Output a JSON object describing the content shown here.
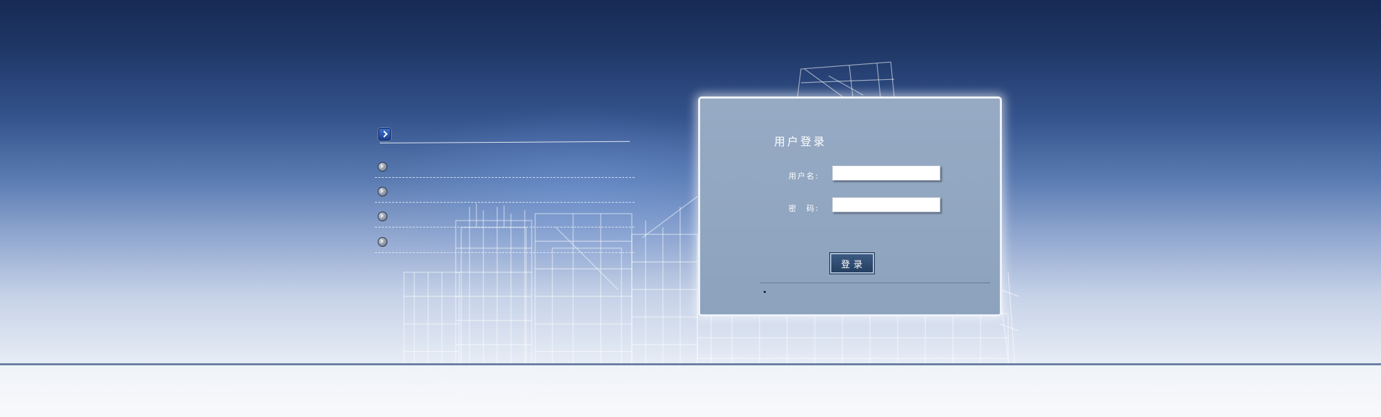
{
  "login": {
    "title": "用户登录",
    "username_label": "用户名:",
    "username_value": "",
    "password_label": "密　码:",
    "password_value": "",
    "submit_label": "登录"
  },
  "news": {
    "header_icon": "arrow-right-icon",
    "items": [
      {
        "label": "",
        "icon": "chevron-right-icon"
      },
      {
        "label": "",
        "icon": "chevron-right-icon"
      },
      {
        "label": "",
        "icon": "chevron-right-icon"
      },
      {
        "label": "",
        "icon": "chevron-right-icon"
      }
    ]
  },
  "colors": {
    "sky_top": "#172a55",
    "sky_mid": "#5a7bb2",
    "panel": "#8fa5bf",
    "button": "#2f4b70",
    "horizon": "#6b7fa3"
  }
}
